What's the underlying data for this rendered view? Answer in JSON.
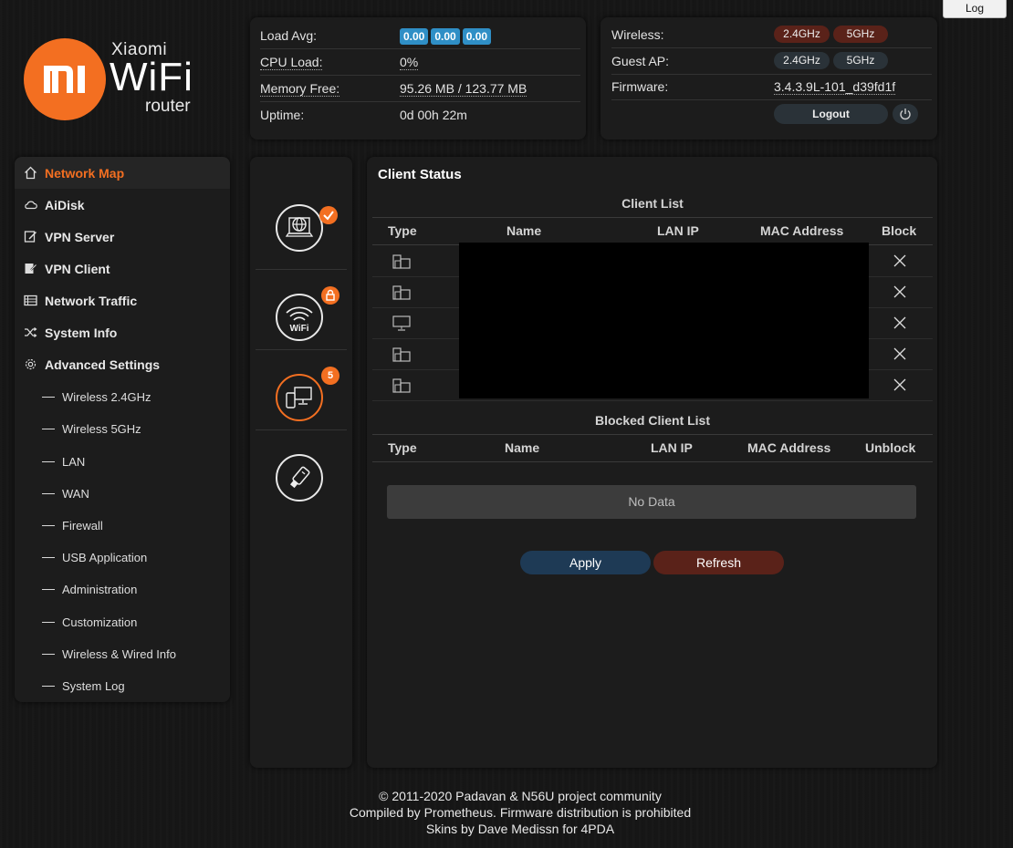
{
  "log_button": "Log",
  "logo": {
    "brand": "Xiaomi",
    "product": "WiFi",
    "sub": "router",
    "mark": "mi"
  },
  "status": {
    "load_avg_label": "Load Avg:",
    "load_avg_values": [
      "0.00",
      "0.00",
      "0.00"
    ],
    "cpu_label": "CPU Load:",
    "cpu_value": "0%",
    "memory_label": "Memory Free:",
    "memory_value": "95.26 MB / 123.77 MB",
    "uptime_label": "Uptime:",
    "uptime_value": "0d 00h 22m"
  },
  "wireless": {
    "wireless_label": "Wireless:",
    "guest_label": "Guest AP:",
    "firmware_label": "Firmware:",
    "firmware_value": "3.4.3.9L-101_d39fd1f",
    "band_24": "2.4GHz",
    "band_5": "5GHz",
    "logout_label": "Logout"
  },
  "sidebar": {
    "items": [
      {
        "label": "Network Map",
        "icon": "home-icon"
      },
      {
        "label": "AiDisk",
        "icon": "cloud-icon"
      },
      {
        "label": "VPN Server",
        "icon": "vpn-server-icon"
      },
      {
        "label": "VPN Client",
        "icon": "vpn-client-icon"
      },
      {
        "label": "Network Traffic",
        "icon": "traffic-icon"
      },
      {
        "label": "System Info",
        "icon": "shuffle-icon"
      },
      {
        "label": "Advanced Settings",
        "icon": "gear-icon"
      }
    ],
    "subitems": [
      "Wireless 2.4GHz",
      "Wireless 5GHz",
      "LAN",
      "WAN",
      "Firewall",
      "USB Application",
      "Administration",
      "Customization",
      "Wireless & Wired Info",
      "System Log"
    ]
  },
  "iconcol": {
    "wifi_text": "WiFi",
    "clients_badge": "5",
    "wifi_badge": "lock-icon"
  },
  "main": {
    "title": "Client Status",
    "client_list_title": "Client List",
    "blocked_list_title": "Blocked Client List",
    "client_headers": [
      "Type",
      "Name",
      "LAN IP",
      "MAC Address",
      "Block"
    ],
    "blocked_headers": [
      "Type",
      "Name",
      "LAN IP",
      "MAC Address",
      "Unblock"
    ],
    "clients": [
      {
        "type_icon": "mobile-device-icon"
      },
      {
        "type_icon": "mobile-device-icon"
      },
      {
        "type_icon": "desktop-icon"
      },
      {
        "type_icon": "mobile-device-icon"
      },
      {
        "type_icon": "mobile-device-icon"
      }
    ],
    "no_data": "No Data",
    "apply_label": "Apply",
    "refresh_label": "Refresh"
  },
  "footer": {
    "line1": "© 2011-2020 Padavan & N56U project community",
    "line2": "Compiled by Prometheus. Firmware distribution is prohibited",
    "line3": "Skins by Dave Medissn for 4PDA"
  },
  "colors": {
    "accent": "#f36f21",
    "on_pill": "#5a2219",
    "off_pill": "#2a3238",
    "badge_blue": "#2f8fc6"
  }
}
